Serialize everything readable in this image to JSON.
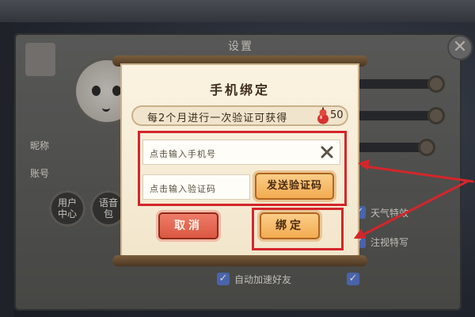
{
  "background": {
    "settings_title": "设置",
    "close_glyph": "✕",
    "nickname_label": "昵称",
    "account_label": "账号",
    "user_center_label": "用户中心",
    "voice_label": "语音包",
    "checkbox_labels": [
      "天气特效",
      "注视特写",
      "自动加速好友"
    ]
  },
  "dialog": {
    "title": "手机绑定",
    "reward_text": "每2个月进行一次验证可获得",
    "reward_icon": "gourd-icon",
    "reward_amount": "50",
    "phone_placeholder": "点击输入手机号",
    "code_placeholder": "点击输入验证码",
    "send_code_label": "发送验证码",
    "cancel_label": "取消",
    "bind_label": "绑定"
  },
  "colors": {
    "annotation_red": "#d4262a",
    "button_orange": "#f2a94d",
    "button_red": "#d9553f",
    "dialog_paper": "#f7edd6"
  }
}
